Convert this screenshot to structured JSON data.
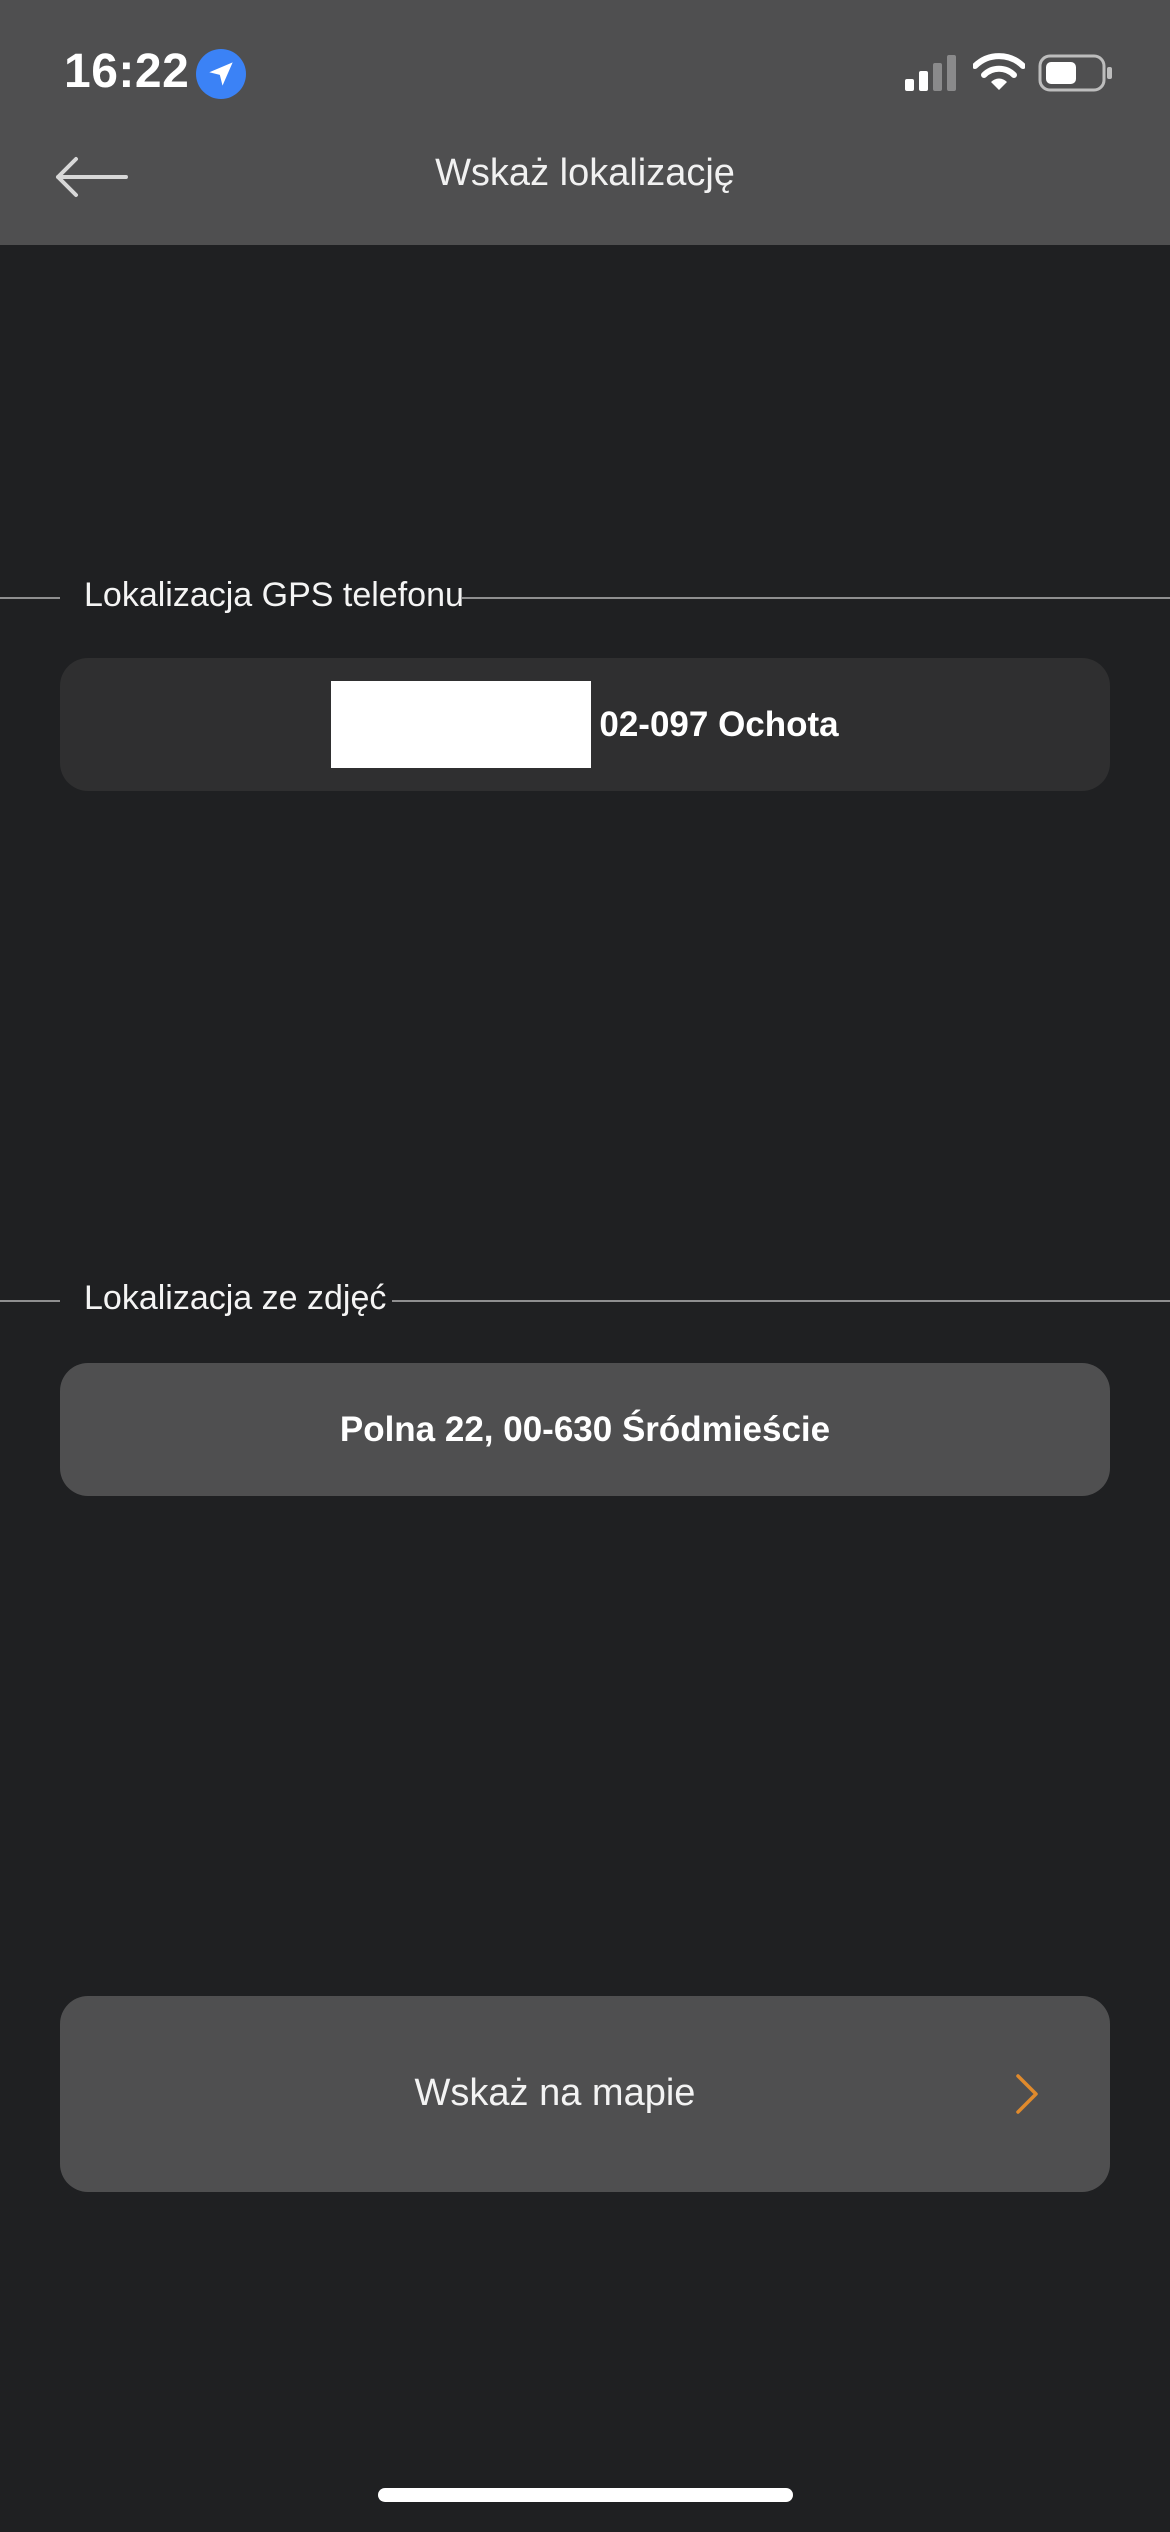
{
  "status_bar": {
    "time": "16:22",
    "location_icon": "location-arrow-icon",
    "signal_icon": "cellular-signal-icon",
    "wifi_icon": "wifi-icon",
    "battery_icon": "battery-icon"
  },
  "header": {
    "back_icon": "back-arrow-icon",
    "title": "Wskaż lokalizację"
  },
  "gps_section": {
    "label": "Lokalizacja GPS telefonu",
    "address_suffix": "02-097 Ochota"
  },
  "photo_section": {
    "label": "Lokalizacja ze zdjęć",
    "address": "Polna 22, 00-630 Śródmieście"
  },
  "map_button": {
    "label": "Wskaż na mapie",
    "chevron_icon": "chevron-right-icon"
  },
  "colors": {
    "background": "#1f2022",
    "header_background": "#4f4f50",
    "card_dark": "#2f2f30",
    "card_light": "#4f4f50",
    "accent": "#e08a2c",
    "location_badge": "#3b82f6"
  }
}
